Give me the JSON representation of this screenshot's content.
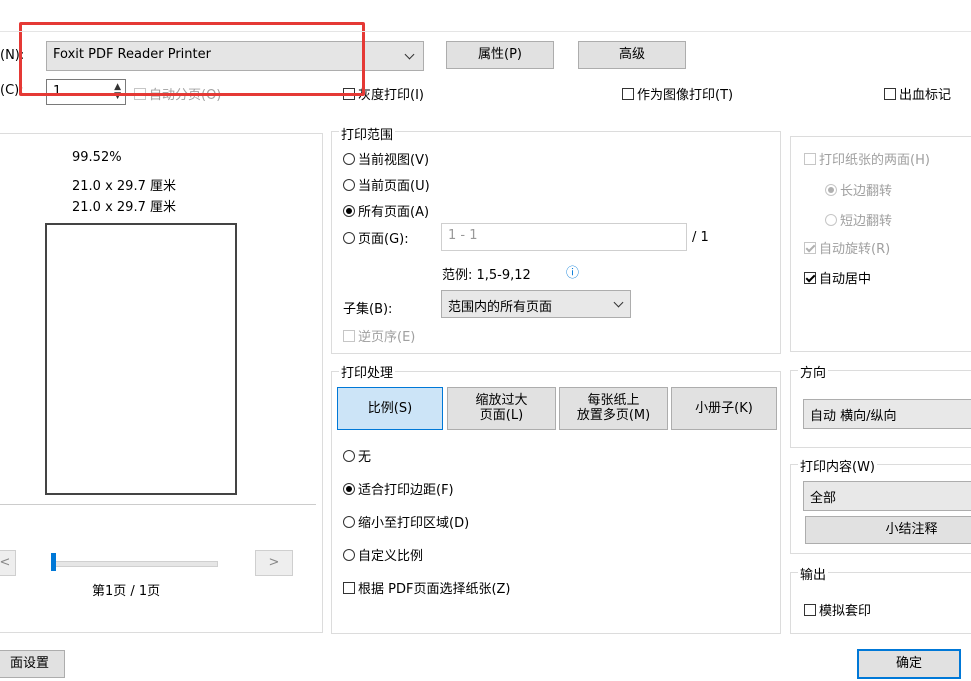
{
  "printer": {
    "name_label": "(N):",
    "name_label_key": "N",
    "name_value": "Foxit PDF Reader Printer",
    "properties_label": "属性(P)",
    "advanced_label": "高级",
    "copies_label": "(C):",
    "copies_key": "C",
    "copies_value": "1",
    "collate_label": "自动分页(O)",
    "grayscale_label": "灰度打印(I)",
    "print_as_image_label": "作为图像打印(T)",
    "bleed_marks_label": "出血标记"
  },
  "preview": {
    "zoom": "99.52%",
    "paper_size_1": "21.0 x 29.7 厘米",
    "paper_size_2": "21.0 x 29.7 厘米",
    "prev_label": "<",
    "next_label": ">",
    "page_status": "第1页 / 1页",
    "page_setup_label": "面设置"
  },
  "print_range": {
    "title": "打印范围",
    "current_view": "当前视图(V)",
    "current_page": "当前页面(U)",
    "all_pages": "所有页面(A)",
    "pages_label": "页面(G):",
    "pages_placeholder": "1 - 1",
    "pages_total": "/ 1",
    "example": "范例: 1,5-9,12",
    "info_icon_glyph": "ⓘ",
    "subset_label": "子集(B):",
    "subset_value": "范围内的所有页面",
    "reverse_label": "逆页序(E)"
  },
  "print_handling": {
    "title": "打印处理",
    "tabs": [
      "比例(S)",
      "缩放过大 页面(L)",
      "每张纸上 放置多页(M)",
      "小册子(K)"
    ],
    "tab_scale": "比例(S)",
    "tab_shrink_line1": "缩放过大",
    "tab_shrink_line2": "页面(L)",
    "tab_multi_line1": "每张纸上",
    "tab_multi_line2": "放置多页(M)",
    "tab_booklet": "小册子(K)",
    "none": "无",
    "fit_margins": "适合打印边距(F)",
    "shrink_to_area": "缩小至打印区域(D)",
    "custom_scale": "自定义比例",
    "choose_paper_by_pdf": "根据 PDF页面选择纸张(Z)"
  },
  "duplex": {
    "both_sides": "打印纸张的两面(H)",
    "long_edge": "长边翻转",
    "short_edge": "短边翻转",
    "auto_rotate": "自动旋转(R)",
    "auto_center": "自动居中"
  },
  "orientation": {
    "title": "方向",
    "value": "自动 横向/纵向"
  },
  "print_content": {
    "title": "打印内容(W)",
    "value": "全部",
    "summarize_label": "小结注释"
  },
  "output": {
    "title": "输出",
    "simulate_overprint": "模拟套印"
  },
  "footer": {
    "ok_label": "确定"
  },
  "colors": {
    "highlight_red": "#e53935",
    "accent_blue": "#0078d7",
    "selected_tab_bg": "#cce4f7"
  }
}
